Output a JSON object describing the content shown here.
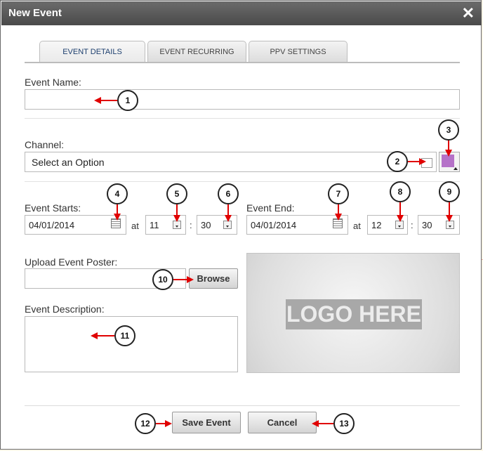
{
  "dialog": {
    "title": "New Event",
    "close_glyph": "✕"
  },
  "tabs": [
    {
      "label": "EVENT DETAILS",
      "active": true
    },
    {
      "label": "EVENT RECURRING",
      "active": false
    },
    {
      "label": "PPV SETTINGS",
      "active": false
    }
  ],
  "form": {
    "event_name_label": "Event Name:",
    "event_name_value": "",
    "channel_label": "Channel:",
    "channel_selected": "Select an Option",
    "channel_color": "#b572c8",
    "event_starts_label": "Event Starts:",
    "start_date": "04/01/2014",
    "at_1": "at",
    "start_hour": "11",
    "colon_1": ":",
    "start_minute": "30",
    "event_end_label": "Event End:",
    "end_date": "04/01/2014",
    "at_2": "at",
    "end_hour": "12",
    "colon_2": ":",
    "end_minute": "30",
    "upload_label": "Upload Event Poster:",
    "upload_value": "",
    "browse_label": "Browse",
    "description_label": "Event Description:",
    "description_value": "",
    "logo_placeholder": "LOGO HERE"
  },
  "footer": {
    "save_label": "Save Event",
    "cancel_label": "Cancel"
  },
  "callouts": [
    "1",
    "2",
    "3",
    "4",
    "5",
    "6",
    "7",
    "8",
    "9",
    "10",
    "11",
    "12",
    "13"
  ],
  "colors": {
    "callout_arrow": "#e00000",
    "title_bar": "#555555",
    "active_tab_text": "#1d3f6e"
  }
}
